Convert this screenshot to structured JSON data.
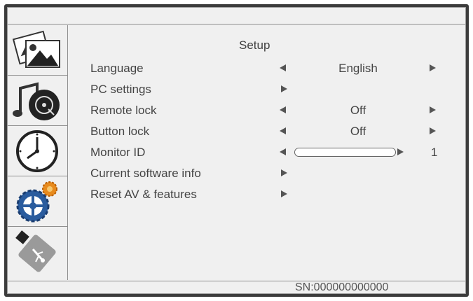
{
  "menu": {
    "title": "Setup",
    "items": [
      {
        "label": "Language",
        "value": "English",
        "type": "selector"
      },
      {
        "label": "PC settings",
        "type": "submenu"
      },
      {
        "label": "Remote lock",
        "value": "Off",
        "type": "selector"
      },
      {
        "label": "Button lock",
        "value": "Off",
        "type": "selector"
      },
      {
        "label": "Monitor ID",
        "value": "1",
        "type": "slider",
        "level": 0.0
      },
      {
        "label": "Current software info",
        "type": "submenu"
      },
      {
        "label": "Reset AV & features",
        "type": "submenu"
      }
    ]
  },
  "sidebar": {
    "items": [
      {
        "icon": "picture-icon"
      },
      {
        "icon": "music-disc-icon"
      },
      {
        "icon": "clock-icon"
      },
      {
        "icon": "gear-icon"
      },
      {
        "icon": "usb-icon"
      }
    ]
  },
  "footer": {
    "serial": "SN:000000000000"
  },
  "colors": {
    "frame": "#3c3c3c",
    "background": "#f0f0f0",
    "text": "#444444",
    "gear_blue": "#2a5c9e",
    "gear_orange": "#e88b1e"
  }
}
